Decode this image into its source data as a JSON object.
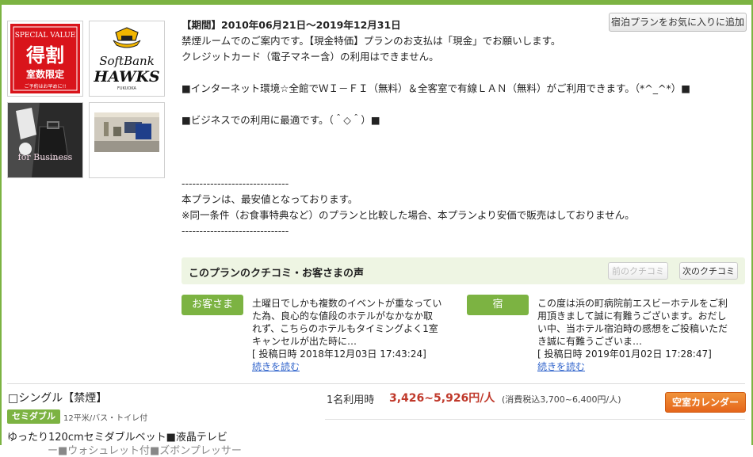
{
  "colors": {
    "accent_green": "#7cb342",
    "price_red": "#c0392b",
    "button_orange": "#e5661b",
    "link_blue": "#3366cc"
  },
  "thumbs": {
    "special": {
      "top": "SPECIAL VALUE",
      "main": "得割",
      "sub": "室数限定",
      "note": "ご予約はお早めに!!"
    },
    "hawks": {
      "line1": "SoftBank",
      "line2": "HAWKS",
      "line3": "FUKUOKA"
    },
    "business": {
      "label": "for Business"
    }
  },
  "plan": {
    "favorite_button": "宿泊プランをお気に入りに追加",
    "period": "【期間】2010年06月21日～2019年12月31日",
    "lines": [
      "禁煙ルームでのご案内です。【現金特価】プランのお支払は「現金」でお願いします。",
      "クレジットカード（電子マネー含）の利用はできません。",
      "",
      "■インターネット環境☆全館でＷＩ－ＦＩ（無料）＆全客室で有線ＬＡＮ（無料）がご利用できます。（*^_^*）■",
      "",
      "■ビジネスでの利用に最適です。（＾◇＾）■",
      "",
      "",
      "",
      "------------------------------",
      "本プランは、最安値となっております。",
      "※同一条件（お食事特典など）のプランと比較した場合、本プランより安価で販売はしておりません。",
      "------------------------------"
    ]
  },
  "reviews": {
    "header": "このプランのクチコミ・お客さまの声",
    "prev_button": "前のクチコミ",
    "next_button": "次のクチコミ",
    "items": [
      {
        "tag": "お客さま",
        "lines": [
          "土曜日でしかも複数のイベントが重なってい",
          "た為、良心的な値段のホテルがなかなか取",
          "れず、こちらのホテルもタイミングよく1室",
          "キャンセルが出た時に…"
        ],
        "date": "[ 投稿日時 2018年12月03日 17:43:24]",
        "more": "続きを読む"
      },
      {
        "tag": "宿",
        "lines": [
          "この度は浜の町病院前エスビーホテルをご利",
          "用頂きまして誠に有難うございます。おだし",
          "い中、当ホテル宿泊時の感想をご投稿いただ",
          "き誠に有難うございま…"
        ],
        "date": "[ 投稿日時 2019年01月02日 17:28:47]",
        "more": "続きを読む"
      }
    ]
  },
  "room": {
    "title": "□シングル【禁煙】",
    "badge": "セミダブル",
    "meta": "12平米/バス・トイレ付",
    "desc": "ゆったり120cmセミダブルベット■液晶テレビ",
    "desc2": "ー■ウォシュレット付■ズボンプレッサー",
    "price_label": "1名利用時",
    "price": "3,426~5,926円/人",
    "price_tax": "(消費税込3,700~6,400円/人)",
    "calendar_button": "空室カレンダー"
  }
}
